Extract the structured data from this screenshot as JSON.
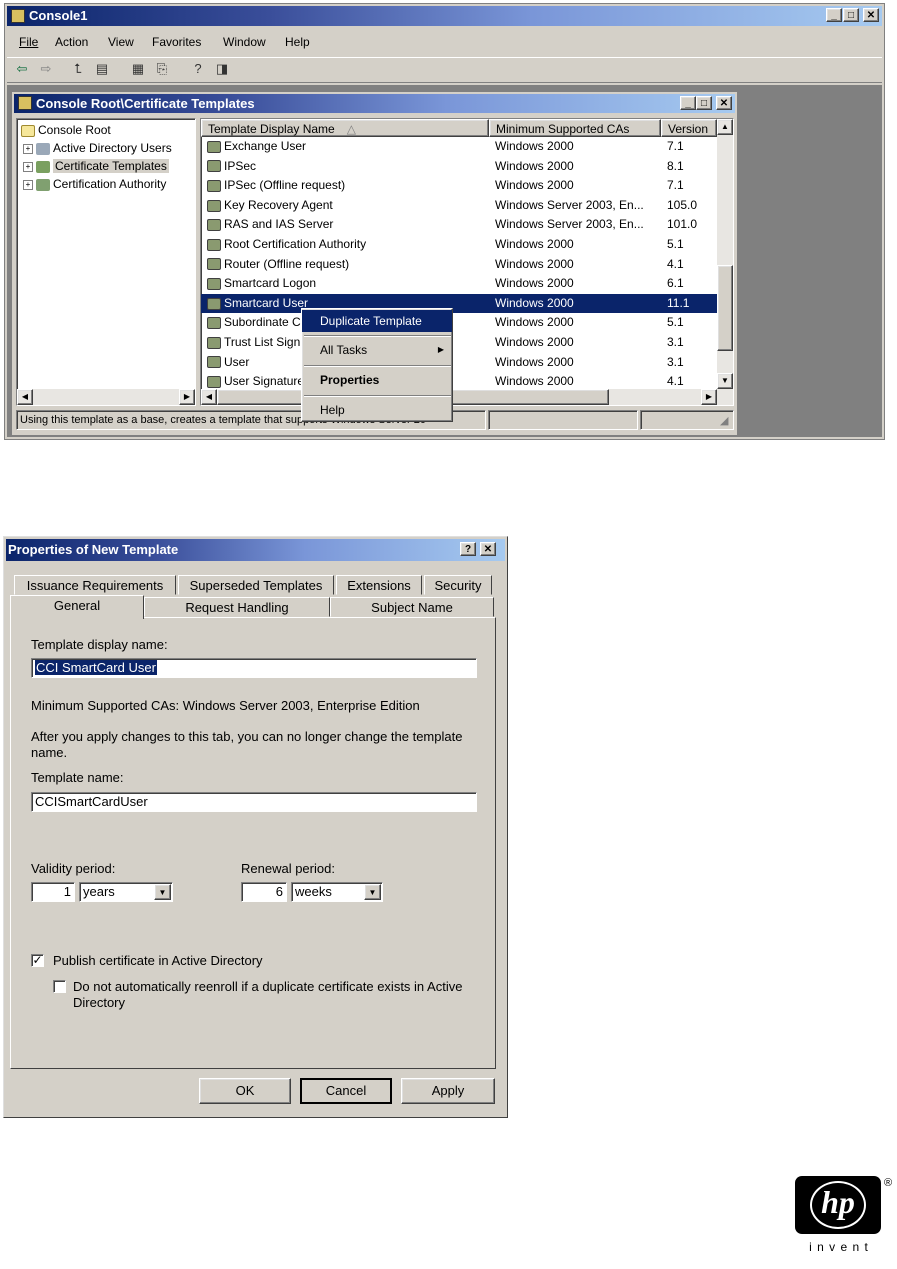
{
  "console": {
    "title": "Console1",
    "menu": [
      "File",
      "Action",
      "View",
      "Favorites",
      "Window",
      "Help"
    ],
    "inner_title": "Console Root\\Certificate Templates",
    "tree": [
      {
        "label": "Console Root"
      },
      {
        "label": "Active Directory Users"
      },
      {
        "label": "Certificate Templates"
      },
      {
        "label": "Certification Authority"
      }
    ],
    "columns": [
      "Template Display Name",
      "Minimum Supported CAs",
      "Version"
    ],
    "rows": [
      {
        "name": "Exchange User",
        "ca": "Windows 2000",
        "version": "7.1"
      },
      {
        "name": "IPSec",
        "ca": "Windows 2000",
        "version": "8.1"
      },
      {
        "name": "IPSec (Offline request)",
        "ca": "Windows 2000",
        "version": "7.1"
      },
      {
        "name": "Key Recovery Agent",
        "ca": "Windows Server 2003, En...",
        "version": "105.0"
      },
      {
        "name": "RAS and IAS Server",
        "ca": "Windows Server 2003, En...",
        "version": "101.0"
      },
      {
        "name": "Root Certification Authority",
        "ca": "Windows 2000",
        "version": "5.1"
      },
      {
        "name": "Router (Offline request)",
        "ca": "Windows 2000",
        "version": "4.1"
      },
      {
        "name": "Smartcard Logon",
        "ca": "Windows 2000",
        "version": "6.1"
      },
      {
        "name": "Smartcard User",
        "ca": "Windows 2000",
        "version": "11.1"
      },
      {
        "name": "Subordinate Certification Authority",
        "ca": "Windows 2000",
        "version": "5.1"
      },
      {
        "name": "Trust List Signing",
        "ca": "Windows 2000",
        "version": "3.1"
      },
      {
        "name": "User",
        "ca": "Windows 2000",
        "version": "3.1"
      },
      {
        "name": "User Signature Only",
        "ca": "Windows 2000",
        "version": "4.1"
      }
    ],
    "context_menu": {
      "duplicate": "Duplicate Template",
      "all_tasks": "All Tasks",
      "properties": "Properties",
      "help": "Help"
    },
    "status": "Using this template as a base, creates a template that supports Windows Server 20"
  },
  "dialog": {
    "title": "Properties of New Template",
    "tabs_back": [
      "Issuance Requirements",
      "Superseded Templates",
      "Extensions",
      "Security"
    ],
    "tabs_front": [
      "General",
      "Request Handling",
      "Subject Name"
    ],
    "display_name_label": "Template display name:",
    "display_name_value": "CCI SmartCard User",
    "min_ca_text": "Minimum Supported CAs:  Windows Server 2003, Enterprise Edition",
    "warning_text_1": "After you apply changes to this tab, you can no longer change the template",
    "warning_text_2": "name.",
    "template_name_label": "Template name:",
    "template_name_value": "CCISmartCardUser",
    "validity_label": "Validity period:",
    "validity_value": "1",
    "validity_unit": "years",
    "renewal_label": "Renewal period:",
    "renewal_value": "6",
    "renewal_unit": "weeks",
    "publish_label": "Publish certificate in Active Directory",
    "publish_checked": true,
    "reenroll_label_1": "Do not automatically reenroll if a duplicate certificate exists in Active",
    "reenroll_label_2": "Directory",
    "reenroll_checked": false,
    "ok": "OK",
    "cancel": "Cancel",
    "apply": "Apply"
  },
  "logo": {
    "text": "hp",
    "tagline": "i n v e n t",
    "registered": "®"
  },
  "colors": {
    "face": "#d4d0c8",
    "selection": "#0a246a",
    "title_start": "#0a246a",
    "title_end": "#a6caf0"
  }
}
